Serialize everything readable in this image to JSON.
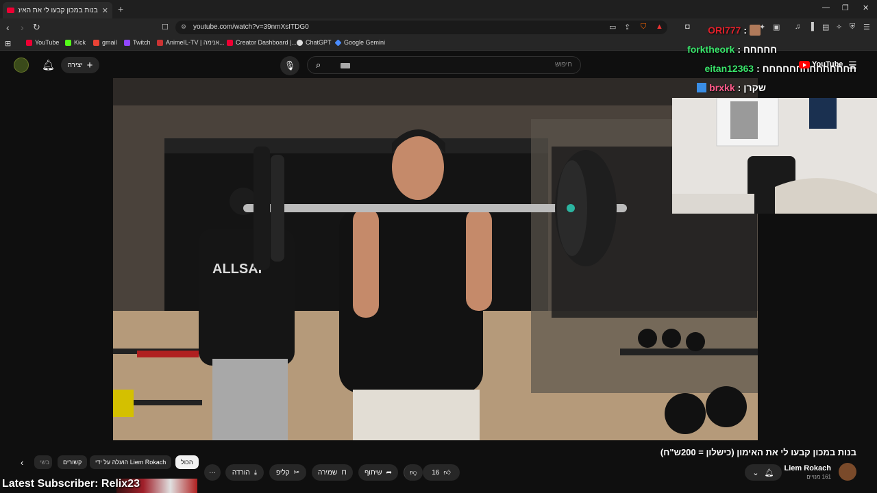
{
  "browser": {
    "tab_title": "בנות במכון קבעו לי את האימון (כי...",
    "tab_close": "✕",
    "new_tab": "+",
    "url": "youtube.com/watch?v=39nmXsITDG0",
    "bookmarks": [
      {
        "label": "YouTube",
        "color": "#e03"
      },
      {
        "label": "Kick",
        "color": "#53fc18"
      },
      {
        "label": "gmail",
        "color": "#ea4335"
      },
      {
        "label": "Twitch",
        "color": "#9146ff"
      },
      {
        "label": "AnimeIL-TV | אנימה...",
        "color": "#c33"
      },
      {
        "label": "Creator Dashboard |...",
        "color": "#e03"
      },
      {
        "label": "ChatGPT",
        "color": "#ddd"
      },
      {
        "label": "Google Gemini",
        "color": "#4a8cff"
      }
    ]
  },
  "youtube": {
    "create_label": "יצירה",
    "search_placeholder": "חיפוש",
    "logo_text": "YouTube"
  },
  "stream_overlay": {
    "chat": [
      {
        "user": "ORI777",
        "message": "",
        "user_color": "#e0202a"
      },
      {
        "user": "forktheork",
        "message": "חחחחח",
        "user_color": "#39e66b"
      },
      {
        "user": "eitan12363",
        "message": "חחחחחחחחחחחחחח",
        "user_color": "#39e66b"
      },
      {
        "user": "brxkk",
        "message": "שקרן",
        "user_color": "#ff5a8a"
      }
    ],
    "latest_subscriber": "Latest Subscriber: Relix23"
  },
  "video": {
    "title": "בנות במכון קבעו לי את האימון (כישלון = 200ש\"ח)",
    "channel_name": "Liem Rokach",
    "subscribers": "161 מנויים",
    "like_count": "16",
    "share_label": "שיתוף",
    "save_label": "שמירה",
    "clip_label": "קליפ",
    "download_label": "הורדה",
    "more_label": "···"
  },
  "chips": [
    {
      "label": "הכול",
      "active": true
    },
    {
      "label": "הועלה על ידי Liem Rokach",
      "active": false
    },
    {
      "label": "קשורים",
      "active": false
    },
    {
      "label": "בשי",
      "active": false
    }
  ]
}
